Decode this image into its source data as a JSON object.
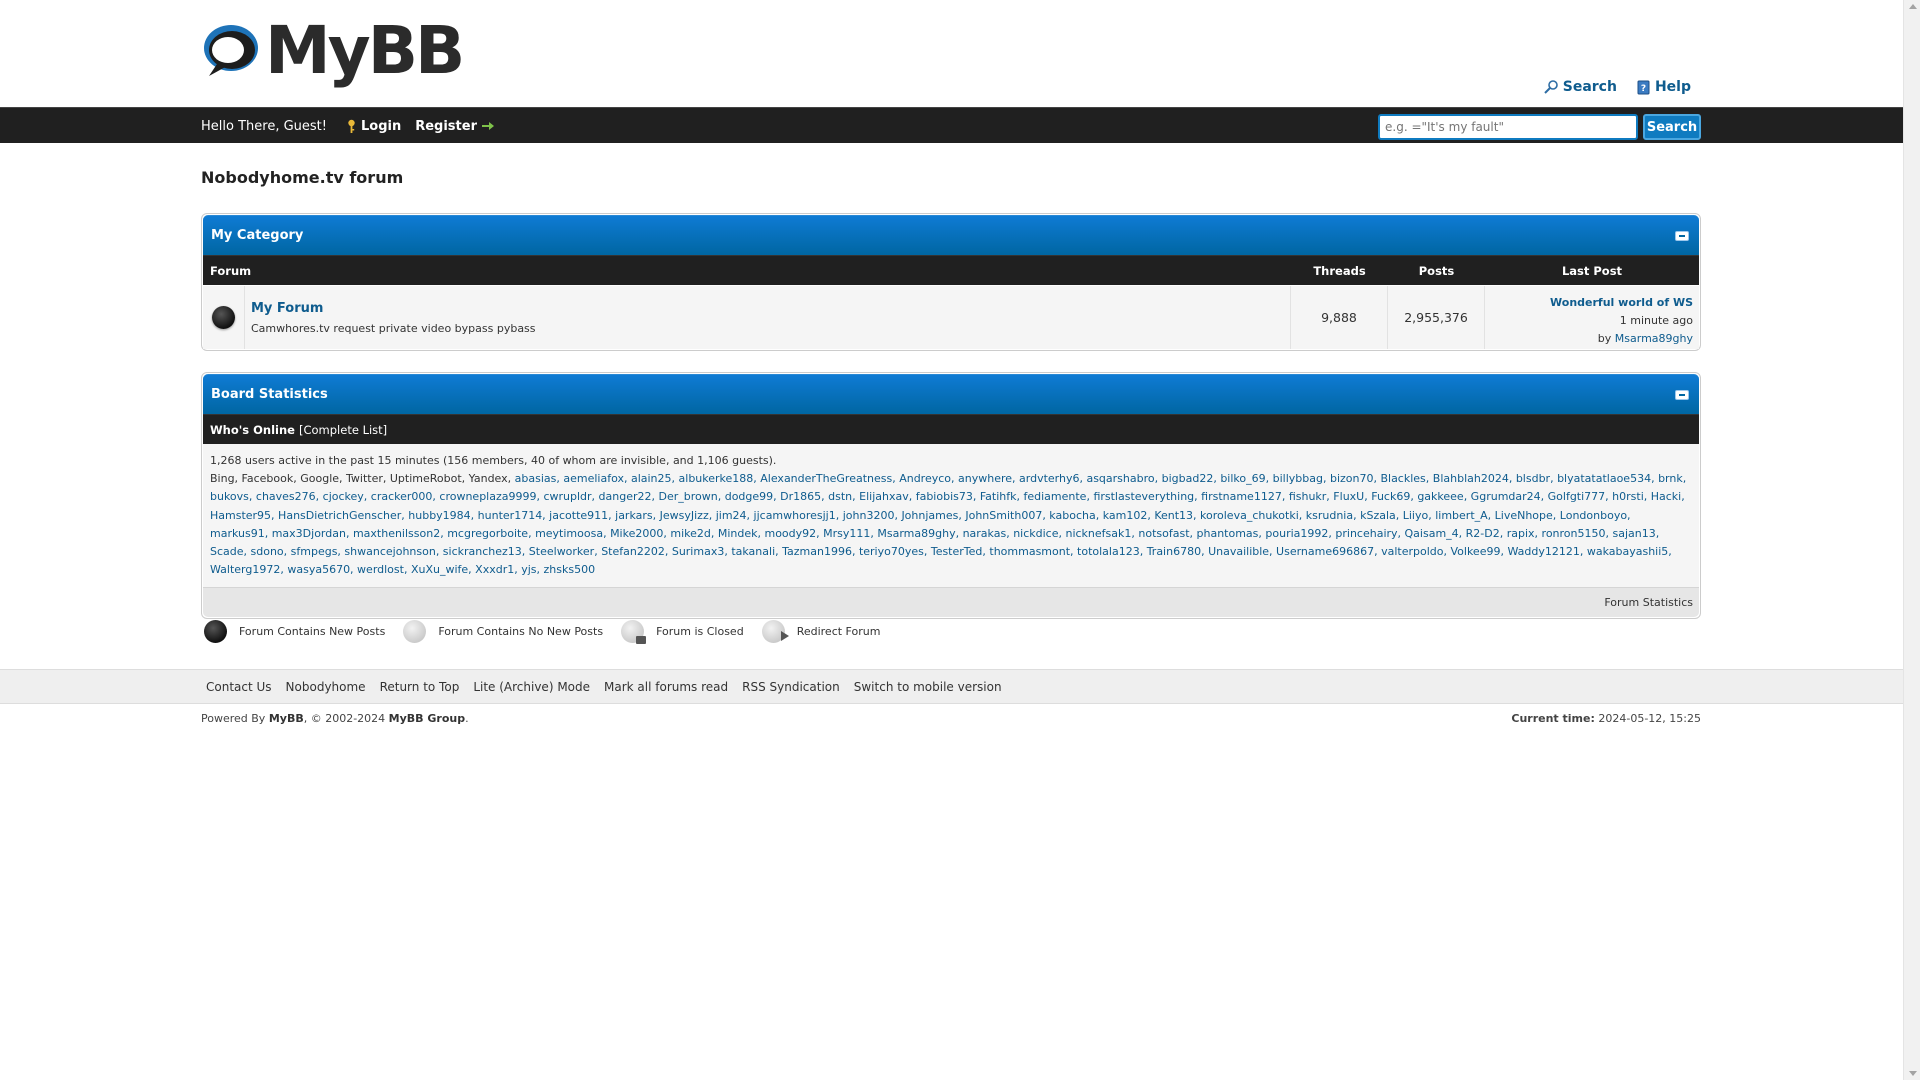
{
  "header": {
    "logo_text": "MyBB",
    "top_links": [
      {
        "label": "Search",
        "icon": "magnifier-icon"
      },
      {
        "label": "Help",
        "icon": "help-book-icon"
      }
    ]
  },
  "navbar": {
    "greeting": "Hello There, Guest!",
    "login_label": "Login",
    "register_label": "Register",
    "search_placeholder": "e.g. =\"It's my fault\"",
    "search_button": "Search"
  },
  "board": {
    "title": "Nobodyhome.tv forum"
  },
  "category": {
    "title": "My Category",
    "columns": {
      "forum": "Forum",
      "threads": "Threads",
      "posts": "Posts",
      "last_post": "Last Post"
    },
    "forums": [
      {
        "name": "My Forum",
        "description": "Camwhores.tv request private video bypass pybass",
        "threads": "9,888",
        "posts": "2,955,376",
        "last_post_title": "Wonderful world of WS",
        "last_post_time": "1 minute ago",
        "last_post_by_prefix": "by",
        "last_post_author": "Msarma89ghy"
      }
    ]
  },
  "statistics": {
    "title": "Board Statistics",
    "whos_online_label": "Who's Online",
    "complete_list_label": "[Complete List]",
    "summary": "1,268 users active in the past 15 minutes (156 members, 40 of whom are invisible, and 1,106 guests).",
    "bots": "Bing, Facebook, Google, Twitter, UptimeRobot, Yandex,",
    "users": "abasias, aemeliafox, alain25, albukerke188, AlexanderTheGreatness, Andreyco, anywhere, ardvterhy6, asqarshabro, bigbad22, bilko_69, billybbag, bizon70, Blackles, Blahblah2024, blsdbr, blyatatatlaoe534, brnk, bukovs, chaves276, cjockey, cracker000, crowneplaza9999, cwrupldr, danger22, Der_brown, dodge99, Dr1865, dstn, Elijahxav, fabiobis73, Fatihfk, fediamente, firstlasteverything, firstname1127, fishukr, FluxU, Fuck69, gakkeee, Ggrumdar24, Golfgti777, h0rsti, Hacki, Hamster95, HansDietrichGenscher, hubby1984, hunter1714, jacotte911, jarkars, JewsyJizz, jim24, jjcamwhoresjj1, john3200, Johnjames, JohnSmith007, kabocha, kam102, Kent13, koroleva_chukotki, ksrudnia, kSzala, Liiyo, limbert_A, LiveNhope, Londonboyo, markus91, max3Djordan, maxthenilsson2, mcgregorboite, meytimoosa, Mike2000, mike2d, Mindek, moody92, Mrsy111, Msarma89ghy, narakas, nickdice, nicknefsak1, notsofast, phantomas, pouria1992, princehairy, Qaisam_4, R2-D2, rapix, ronron5150, sajan13, Scade, sdono, sfmpegs, shwancejohnson, sickranchez13, Steelworker, Stefan2202, Surimax3, takanali, Tazman1996, teriyo70yes, TesterTed, thommasmont, totolala123, Train6780, Unavailible, Username696867, valterpoldo, Volkee99, Waddy12121, wakabayashii5, Walterg1972, wasya5670, werdlost, XuXu_wife, Xxxdr1, yjs, zhsks500",
    "footer_link": "Forum Statistics"
  },
  "legend": [
    {
      "label": "Forum Contains New Posts",
      "icon": "forum-new-posts-icon"
    },
    {
      "label": "Forum Contains No New Posts",
      "icon": "forum-no-new-posts-icon"
    },
    {
      "label": "Forum is Closed",
      "icon": "forum-closed-icon"
    },
    {
      "label": "Redirect Forum",
      "icon": "forum-redirect-icon"
    }
  ],
  "footer": {
    "links": [
      "Contact Us",
      "Nobodyhome",
      "Return to Top",
      "Lite (Archive) Mode",
      "Mark all forums read",
      "RSS Syndication",
      "Switch to mobile version"
    ],
    "powered_by_prefix": "Powered By",
    "powered_by_brand": "MyBB",
    "copyright_years": ", © 2002-2024",
    "copyright_owner": "MyBB Group",
    "current_time_label": "Current time:",
    "current_time_value": "2024-05-12, 15:25"
  },
  "colors": {
    "accent_blue": "#0f7bc0",
    "link_blue": "#0f5c8e",
    "nav_dark": "#202020"
  }
}
